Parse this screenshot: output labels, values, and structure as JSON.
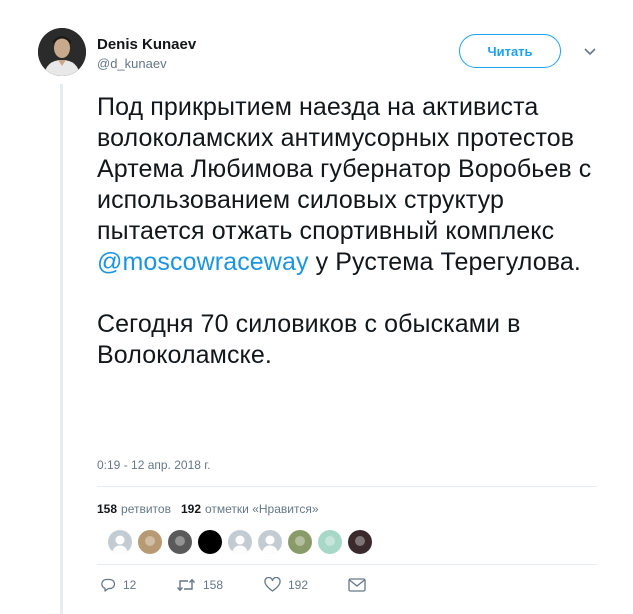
{
  "author": {
    "name": "Denis Kunaev",
    "handle": "@d_kunaev"
  },
  "follow_button": {
    "label": "Читать"
  },
  "tweet": {
    "paragraph1_before": "Под прикрытием наезда на активиста волоколамских антимусорных протестов Артема Любимова губернатор Воробьев с использованием силовых структур пытается отжать спортивный комплекс ",
    "mention": "@moscowraceway",
    "paragraph1_after": " у Рустема Терегулова.",
    "paragraph2": "Сегодня 70 силовиков с обысками в Волоколамске.",
    "timestamp": "0:19 - 12 апр. 2018 г."
  },
  "stats": {
    "retweets_count": "158",
    "retweets_label": "ретвитов",
    "likes_count": "192",
    "likes_label": "отметки «Нравится»"
  },
  "likers": [
    {
      "avatar": "default-avatar-gray",
      "color": "#c4ccd3"
    },
    {
      "avatar": "bearded-man-avatar",
      "color": "#b79a73"
    },
    {
      "avatar": "person-avatar-dark",
      "color": "#5a5a5a"
    },
    {
      "avatar": "black-avatar",
      "color": "#000000"
    },
    {
      "avatar": "default-avatar-gray",
      "color": "#c4ccd3"
    },
    {
      "avatar": "default-avatar-gray",
      "color": "#c4ccd3"
    },
    {
      "avatar": "landscape-avatar",
      "color": "#8a9b6a"
    },
    {
      "avatar": "cartoon-avatar",
      "color": "#a8d8c8"
    },
    {
      "avatar": "woman-avatar-dark",
      "color": "#3a2a2e"
    }
  ],
  "actions": {
    "reply_count": "12",
    "retweet_count": "158",
    "like_count": "192"
  },
  "colors": {
    "accent": "#1da1f2",
    "mention": "#1b95e0",
    "muted": "#657786"
  }
}
